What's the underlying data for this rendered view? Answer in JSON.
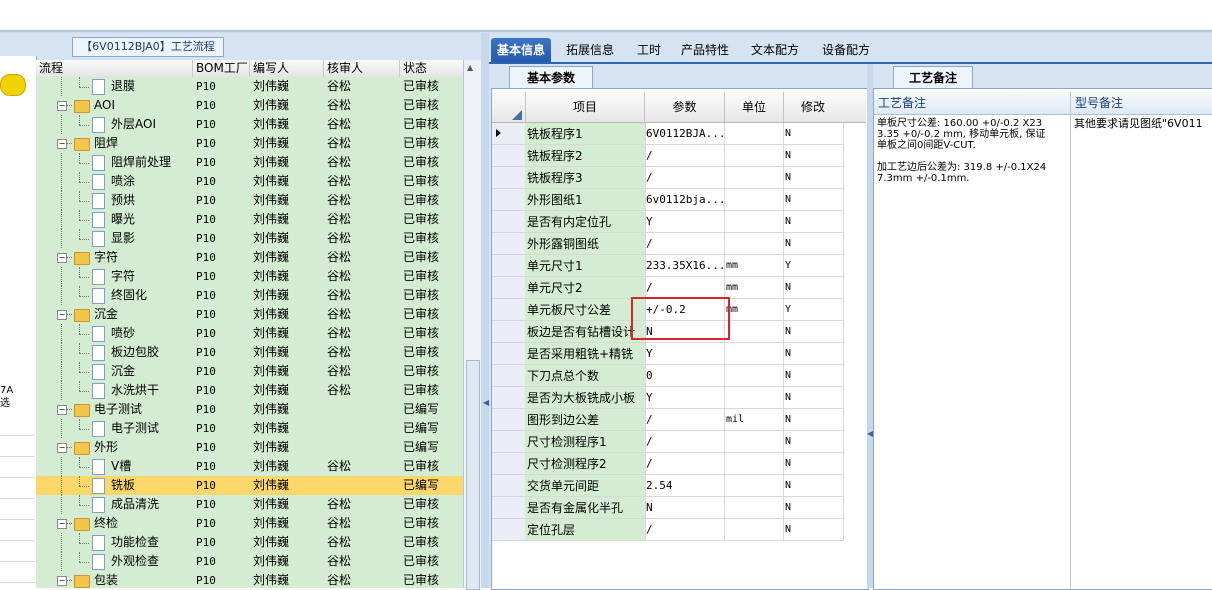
{
  "left_title": "【6V0112BJA0】工艺流程",
  "side": {
    "line1": "7A",
    "line2": "选"
  },
  "tree": {
    "headers": {
      "flow": "流程",
      "bom": "BOM工厂",
      "writer": "编写人",
      "reviewer": "核审人",
      "status": "状态"
    },
    "rows": [
      {
        "name": "退膜",
        "type": "item",
        "bom": "P10",
        "writer": "刘伟巍",
        "reviewer": "谷松",
        "status": "已审核"
      },
      {
        "name": "AOI",
        "type": "folder",
        "bom": "P10",
        "writer": "刘伟巍",
        "reviewer": "谷松",
        "status": "已审核"
      },
      {
        "name": "外层AOI",
        "type": "item",
        "bom": "P10",
        "writer": "刘伟巍",
        "reviewer": "谷松",
        "status": "已审核"
      },
      {
        "name": "阻焊",
        "type": "folder",
        "bom": "P10",
        "writer": "刘伟巍",
        "reviewer": "谷松",
        "status": "已审核"
      },
      {
        "name": "阻焊前处理",
        "type": "item",
        "bom": "P10",
        "writer": "刘伟巍",
        "reviewer": "谷松",
        "status": "已审核"
      },
      {
        "name": "喷涂",
        "type": "item",
        "bom": "P10",
        "writer": "刘伟巍",
        "reviewer": "谷松",
        "status": "已审核"
      },
      {
        "name": "预烘",
        "type": "item",
        "bom": "P10",
        "writer": "刘伟巍",
        "reviewer": "谷松",
        "status": "已审核"
      },
      {
        "name": "曝光",
        "type": "item",
        "bom": "P10",
        "writer": "刘伟巍",
        "reviewer": "谷松",
        "status": "已审核"
      },
      {
        "name": "显影",
        "type": "item",
        "bom": "P10",
        "writer": "刘伟巍",
        "reviewer": "谷松",
        "status": "已审核"
      },
      {
        "name": "字符",
        "type": "folder",
        "bom": "P10",
        "writer": "刘伟巍",
        "reviewer": "谷松",
        "status": "已审核"
      },
      {
        "name": "字符",
        "type": "item",
        "bom": "P10",
        "writer": "刘伟巍",
        "reviewer": "谷松",
        "status": "已审核"
      },
      {
        "name": "终固化",
        "type": "item",
        "bom": "P10",
        "writer": "刘伟巍",
        "reviewer": "谷松",
        "status": "已审核"
      },
      {
        "name": "沉金",
        "type": "folder",
        "bom": "P10",
        "writer": "刘伟巍",
        "reviewer": "谷松",
        "status": "已审核"
      },
      {
        "name": "喷砂",
        "type": "item",
        "bom": "P10",
        "writer": "刘伟巍",
        "reviewer": "谷松",
        "status": "已审核"
      },
      {
        "name": "板边包胶",
        "type": "item",
        "bom": "P10",
        "writer": "刘伟巍",
        "reviewer": "谷松",
        "status": "已审核"
      },
      {
        "name": "沉金",
        "type": "item",
        "bom": "P10",
        "writer": "刘伟巍",
        "reviewer": "谷松",
        "status": "已审核"
      },
      {
        "name": "水洗烘干",
        "type": "item",
        "bom": "P10",
        "writer": "刘伟巍",
        "reviewer": "谷松",
        "status": "已审核"
      },
      {
        "name": "电子测试",
        "type": "folder",
        "bom": "P10",
        "writer": "刘伟巍",
        "reviewer": "",
        "status": "已编写"
      },
      {
        "name": "电子测试",
        "type": "item",
        "bom": "P10",
        "writer": "刘伟巍",
        "reviewer": "",
        "status": "已编写"
      },
      {
        "name": "外形",
        "type": "folder",
        "bom": "P10",
        "writer": "刘伟巍",
        "reviewer": "",
        "status": "已编写"
      },
      {
        "name": "V槽",
        "type": "item",
        "bom": "P10",
        "writer": "刘伟巍",
        "reviewer": "谷松",
        "status": "已审核"
      },
      {
        "name": "铣板",
        "type": "item",
        "bom": "P10",
        "writer": "刘伟巍",
        "reviewer": "",
        "status": "已编写",
        "selected": true
      },
      {
        "name": "成品清洗",
        "type": "item",
        "bom": "P10",
        "writer": "刘伟巍",
        "reviewer": "谷松",
        "status": "已审核"
      },
      {
        "name": "终检",
        "type": "folder",
        "bom": "P10",
        "writer": "刘伟巍",
        "reviewer": "谷松",
        "status": "已审核"
      },
      {
        "name": "功能检查",
        "type": "item",
        "bom": "P10",
        "writer": "刘伟巍",
        "reviewer": "谷松",
        "status": "已审核"
      },
      {
        "name": "外观检查",
        "type": "item",
        "bom": "P10",
        "writer": "刘伟巍",
        "reviewer": "谷松",
        "status": "已审核"
      },
      {
        "name": "包装",
        "type": "folder",
        "bom": "P10",
        "writer": "刘伟巍",
        "reviewer": "谷松",
        "status": "已审核"
      }
    ]
  },
  "main_tabs": [
    "基本信息",
    "拓展信息",
    "工时",
    "产品特性",
    "文本配方",
    "设备配方"
  ],
  "basic_params": {
    "tab_label": "基本参数",
    "headers": {
      "item": "项目",
      "param": "参数",
      "unit": "单位",
      "modify": "修改"
    },
    "rows": [
      {
        "item": "铣板程序1",
        "param": "6V0112BJA...",
        "unit": "",
        "modify": "N"
      },
      {
        "item": "铣板程序2",
        "param": "/",
        "unit": "",
        "modify": "N"
      },
      {
        "item": "铣板程序3",
        "param": "/",
        "unit": "",
        "modify": "N"
      },
      {
        "item": "外形图纸1",
        "param": "6v0112bja...",
        "unit": "",
        "modify": "N"
      },
      {
        "item": "是否有内定位孔",
        "param": "Y",
        "unit": "",
        "modify": "N"
      },
      {
        "item": "外形露铜图纸",
        "param": "/",
        "unit": "",
        "modify": "N"
      },
      {
        "item": "单元尺寸1",
        "param": "233.35X16...",
        "unit": "mm",
        "modify": "Y"
      },
      {
        "item": "单元尺寸2",
        "param": "/",
        "unit": "mm",
        "modify": "N"
      },
      {
        "item": "单元板尺寸公差",
        "param": "+/-0.2",
        "unit": "mm",
        "modify": "Y"
      },
      {
        "item": "板边是否有钻槽设计",
        "param": "N",
        "unit": "",
        "modify": "N"
      },
      {
        "item": "是否采用粗铣+精铣",
        "param": "Y",
        "unit": "",
        "modify": "N"
      },
      {
        "item": "下刀点总个数",
        "param": "0",
        "unit": "",
        "modify": "N"
      },
      {
        "item": "是否为大板铣成小板",
        "param": "Y",
        "unit": "",
        "modify": "N"
      },
      {
        "item": "图形到边公差",
        "param": "/",
        "unit": "mil",
        "modify": "N"
      },
      {
        "item": "尺寸检测程序1",
        "param": "/",
        "unit": "",
        "modify": "N"
      },
      {
        "item": "尺寸检测程序2",
        "param": "/",
        "unit": "",
        "modify": "N"
      },
      {
        "item": "交货单元间距",
        "param": "2.54",
        "unit": "",
        "modify": "N"
      },
      {
        "item": "是否有金属化半孔",
        "param": "N",
        "unit": "",
        "modify": "N"
      },
      {
        "item": "定位孔层",
        "param": "/",
        "unit": "",
        "modify": "N"
      }
    ]
  },
  "process_remark": {
    "tab_label": "工艺备注",
    "col1_header": "工艺备注",
    "col2_header": "型号备注",
    "col1_text": "单板尺寸公差: 160.00 +0/-0.2 X233.35 +0/-0.2 mm, 移动单元板, 保证单板之间0间距V-CUT.\n\n加工艺边后公差为: 319.8 +/-0.1X247.3mm +/-0.1mm.",
    "col2_text": "其他要求请见图纸\"6V011"
  }
}
